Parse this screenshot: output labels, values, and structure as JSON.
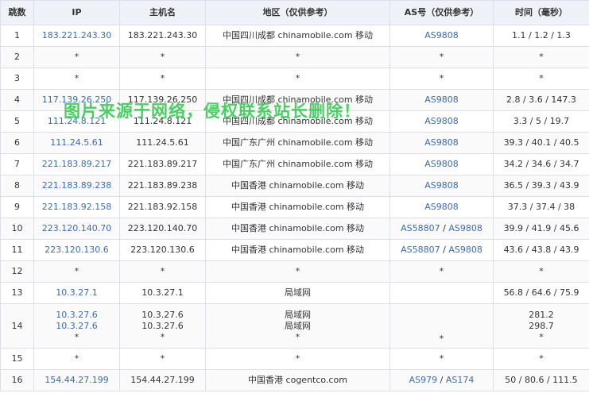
{
  "headers": {
    "hop": "跳数",
    "ip": "IP",
    "host": "主机名",
    "region": "地区（仅供参考）",
    "as": "AS号（仅供参考）",
    "time": "时间（毫秒）"
  },
  "watermark": "图片来源于网络，侵权联系站长删除！",
  "rows": [
    {
      "hop": "1",
      "ip": [
        "183.221.243.30"
      ],
      "ip_link": true,
      "host": [
        "183.221.243.30"
      ],
      "region": [
        "中国四川成都 chinamobile.com 移动"
      ],
      "as": [
        "AS9808"
      ],
      "time": [
        "1.1 / 1.2 / 1.3"
      ]
    },
    {
      "hop": "2",
      "ip": [
        "*"
      ],
      "ip_link": false,
      "host": [
        "*"
      ],
      "region": [
        "*"
      ],
      "as": [],
      "as_text": "*",
      "time": [
        "*"
      ]
    },
    {
      "hop": "3",
      "ip": [
        "*"
      ],
      "ip_link": false,
      "host": [
        "*"
      ],
      "region": [
        "*"
      ],
      "as": [],
      "as_text": "*",
      "time": [
        "*"
      ]
    },
    {
      "hop": "4",
      "ip": [
        "117.139.26.250"
      ],
      "ip_link": true,
      "host": [
        "117.139.26.250"
      ],
      "region": [
        "中国四川成都 chinamobile.com 移动"
      ],
      "as": [
        "AS9808"
      ],
      "time": [
        "2.8 / 3.6 / 147.3"
      ]
    },
    {
      "hop": "5",
      "ip": [
        "111.24.8.121"
      ],
      "ip_link": true,
      "host": [
        "111.24.8.121"
      ],
      "region": [
        "中国四川成都 chinamobile.com 移动"
      ],
      "as": [
        "AS9808"
      ],
      "time": [
        "3.3 / 5 / 19.7"
      ]
    },
    {
      "hop": "6",
      "ip": [
        "111.24.5.61"
      ],
      "ip_link": true,
      "host": [
        "111.24.5.61"
      ],
      "region": [
        "中国广东广州 chinamobile.com 移动"
      ],
      "as": [
        "AS9808"
      ],
      "time": [
        "39.3 / 40.1 / 40.5"
      ]
    },
    {
      "hop": "7",
      "ip": [
        "221.183.89.217"
      ],
      "ip_link": true,
      "host": [
        "221.183.89.217"
      ],
      "region": [
        "中国广东广州 chinamobile.com 移动"
      ],
      "as": [
        "AS9808"
      ],
      "time": [
        "34.2 / 34.6 / 34.7"
      ]
    },
    {
      "hop": "8",
      "ip": [
        "221.183.89.238"
      ],
      "ip_link": true,
      "host": [
        "221.183.89.238"
      ],
      "region": [
        "中国香港 chinamobile.com 移动"
      ],
      "as": [
        "AS9808"
      ],
      "time": [
        "36.5 / 39.3 / 43.9"
      ]
    },
    {
      "hop": "9",
      "ip": [
        "221.183.92.158"
      ],
      "ip_link": true,
      "host": [
        "221.183.92.158"
      ],
      "region": [
        "中国香港 chinamobile.com 移动"
      ],
      "as": [
        "AS9808"
      ],
      "time": [
        "37.3 / 37.4 / 38"
      ]
    },
    {
      "hop": "10",
      "ip": [
        "223.120.140.70"
      ],
      "ip_link": true,
      "host": [
        "223.120.140.70"
      ],
      "region": [
        "中国香港 chinamobile.com 移动"
      ],
      "as": [
        "AS58807",
        "AS9808"
      ],
      "time": [
        "39.9 / 41.9 / 45.6"
      ]
    },
    {
      "hop": "11",
      "ip": [
        "223.120.130.6"
      ],
      "ip_link": true,
      "host": [
        "223.120.130.6"
      ],
      "region": [
        "中国香港 chinamobile.com 移动"
      ],
      "as": [
        "AS58807",
        "AS9808"
      ],
      "time": [
        "43.6 / 43.8 / 43.9"
      ]
    },
    {
      "hop": "12",
      "ip": [
        "*"
      ],
      "ip_link": false,
      "host": [
        "*"
      ],
      "region": [
        "*"
      ],
      "as": [],
      "as_text": "*",
      "time": [
        "*"
      ]
    },
    {
      "hop": "13",
      "ip": [
        "10.3.27.1"
      ],
      "ip_link": true,
      "host": [
        "10.3.27.1"
      ],
      "region": [
        "局域网"
      ],
      "as": [],
      "as_text": "",
      "time": [
        "56.8 / 64.6 / 75.9"
      ]
    },
    {
      "hop": "14",
      "tall": true,
      "ip": [
        "10.3.27.6",
        "10.3.27.6",
        "*"
      ],
      "ip_link": true,
      "host": [
        "10.3.27.6",
        "10.3.27.6",
        "*"
      ],
      "region": [
        "局域网",
        "局域网",
        "*"
      ],
      "as": [],
      "as_text": "*",
      "time": [
        "281.2",
        "298.7",
        "*"
      ]
    },
    {
      "hop": "15",
      "ip": [
        "*"
      ],
      "ip_link": false,
      "host": [
        "*"
      ],
      "region": [
        "*"
      ],
      "as": [],
      "as_text": "*",
      "time": [
        "*"
      ]
    },
    {
      "hop": "16",
      "ip": [
        "154.44.27.199"
      ],
      "ip_link": true,
      "host": [
        "154.44.27.199"
      ],
      "region": [
        "中国香港 cogentco.com"
      ],
      "as": [
        "AS979",
        "AS174"
      ],
      "time": [
        "50 / 80.6 / 111.5"
      ]
    }
  ]
}
